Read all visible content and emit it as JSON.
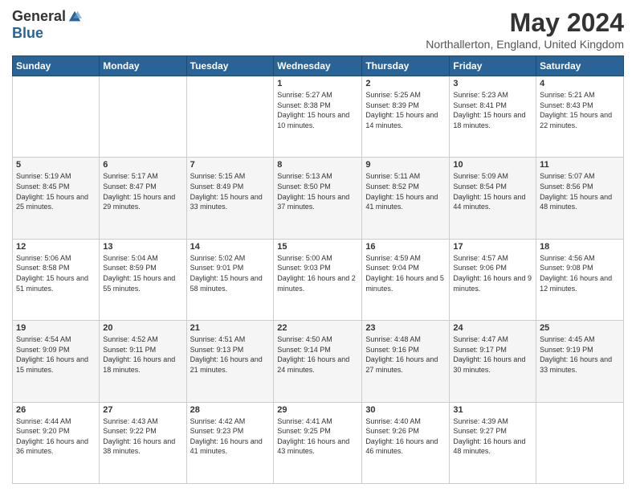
{
  "logo": {
    "general": "General",
    "blue": "Blue"
  },
  "title": "May 2024",
  "location": "Northallerton, England, United Kingdom",
  "days_of_week": [
    "Sunday",
    "Monday",
    "Tuesday",
    "Wednesday",
    "Thursday",
    "Friday",
    "Saturday"
  ],
  "weeks": [
    [
      {
        "day": "",
        "info": ""
      },
      {
        "day": "",
        "info": ""
      },
      {
        "day": "",
        "info": ""
      },
      {
        "day": "1",
        "info": "Sunrise: 5:27 AM\nSunset: 8:38 PM\nDaylight: 15 hours and 10 minutes."
      },
      {
        "day": "2",
        "info": "Sunrise: 5:25 AM\nSunset: 8:39 PM\nDaylight: 15 hours and 14 minutes."
      },
      {
        "day": "3",
        "info": "Sunrise: 5:23 AM\nSunset: 8:41 PM\nDaylight: 15 hours and 18 minutes."
      },
      {
        "day": "4",
        "info": "Sunrise: 5:21 AM\nSunset: 8:43 PM\nDaylight: 15 hours and 22 minutes."
      }
    ],
    [
      {
        "day": "5",
        "info": "Sunrise: 5:19 AM\nSunset: 8:45 PM\nDaylight: 15 hours and 25 minutes."
      },
      {
        "day": "6",
        "info": "Sunrise: 5:17 AM\nSunset: 8:47 PM\nDaylight: 15 hours and 29 minutes."
      },
      {
        "day": "7",
        "info": "Sunrise: 5:15 AM\nSunset: 8:49 PM\nDaylight: 15 hours and 33 minutes."
      },
      {
        "day": "8",
        "info": "Sunrise: 5:13 AM\nSunset: 8:50 PM\nDaylight: 15 hours and 37 minutes."
      },
      {
        "day": "9",
        "info": "Sunrise: 5:11 AM\nSunset: 8:52 PM\nDaylight: 15 hours and 41 minutes."
      },
      {
        "day": "10",
        "info": "Sunrise: 5:09 AM\nSunset: 8:54 PM\nDaylight: 15 hours and 44 minutes."
      },
      {
        "day": "11",
        "info": "Sunrise: 5:07 AM\nSunset: 8:56 PM\nDaylight: 15 hours and 48 minutes."
      }
    ],
    [
      {
        "day": "12",
        "info": "Sunrise: 5:06 AM\nSunset: 8:58 PM\nDaylight: 15 hours and 51 minutes."
      },
      {
        "day": "13",
        "info": "Sunrise: 5:04 AM\nSunset: 8:59 PM\nDaylight: 15 hours and 55 minutes."
      },
      {
        "day": "14",
        "info": "Sunrise: 5:02 AM\nSunset: 9:01 PM\nDaylight: 15 hours and 58 minutes."
      },
      {
        "day": "15",
        "info": "Sunrise: 5:00 AM\nSunset: 9:03 PM\nDaylight: 16 hours and 2 minutes."
      },
      {
        "day": "16",
        "info": "Sunrise: 4:59 AM\nSunset: 9:04 PM\nDaylight: 16 hours and 5 minutes."
      },
      {
        "day": "17",
        "info": "Sunrise: 4:57 AM\nSunset: 9:06 PM\nDaylight: 16 hours and 9 minutes."
      },
      {
        "day": "18",
        "info": "Sunrise: 4:56 AM\nSunset: 9:08 PM\nDaylight: 16 hours and 12 minutes."
      }
    ],
    [
      {
        "day": "19",
        "info": "Sunrise: 4:54 AM\nSunset: 9:09 PM\nDaylight: 16 hours and 15 minutes."
      },
      {
        "day": "20",
        "info": "Sunrise: 4:52 AM\nSunset: 9:11 PM\nDaylight: 16 hours and 18 minutes."
      },
      {
        "day": "21",
        "info": "Sunrise: 4:51 AM\nSunset: 9:13 PM\nDaylight: 16 hours and 21 minutes."
      },
      {
        "day": "22",
        "info": "Sunrise: 4:50 AM\nSunset: 9:14 PM\nDaylight: 16 hours and 24 minutes."
      },
      {
        "day": "23",
        "info": "Sunrise: 4:48 AM\nSunset: 9:16 PM\nDaylight: 16 hours and 27 minutes."
      },
      {
        "day": "24",
        "info": "Sunrise: 4:47 AM\nSunset: 9:17 PM\nDaylight: 16 hours and 30 minutes."
      },
      {
        "day": "25",
        "info": "Sunrise: 4:45 AM\nSunset: 9:19 PM\nDaylight: 16 hours and 33 minutes."
      }
    ],
    [
      {
        "day": "26",
        "info": "Sunrise: 4:44 AM\nSunset: 9:20 PM\nDaylight: 16 hours and 36 minutes."
      },
      {
        "day": "27",
        "info": "Sunrise: 4:43 AM\nSunset: 9:22 PM\nDaylight: 16 hours and 38 minutes."
      },
      {
        "day": "28",
        "info": "Sunrise: 4:42 AM\nSunset: 9:23 PM\nDaylight: 16 hours and 41 minutes."
      },
      {
        "day": "29",
        "info": "Sunrise: 4:41 AM\nSunset: 9:25 PM\nDaylight: 16 hours and 43 minutes."
      },
      {
        "day": "30",
        "info": "Sunrise: 4:40 AM\nSunset: 9:26 PM\nDaylight: 16 hours and 46 minutes."
      },
      {
        "day": "31",
        "info": "Sunrise: 4:39 AM\nSunset: 9:27 PM\nDaylight: 16 hours and 48 minutes."
      },
      {
        "day": "",
        "info": ""
      }
    ]
  ]
}
